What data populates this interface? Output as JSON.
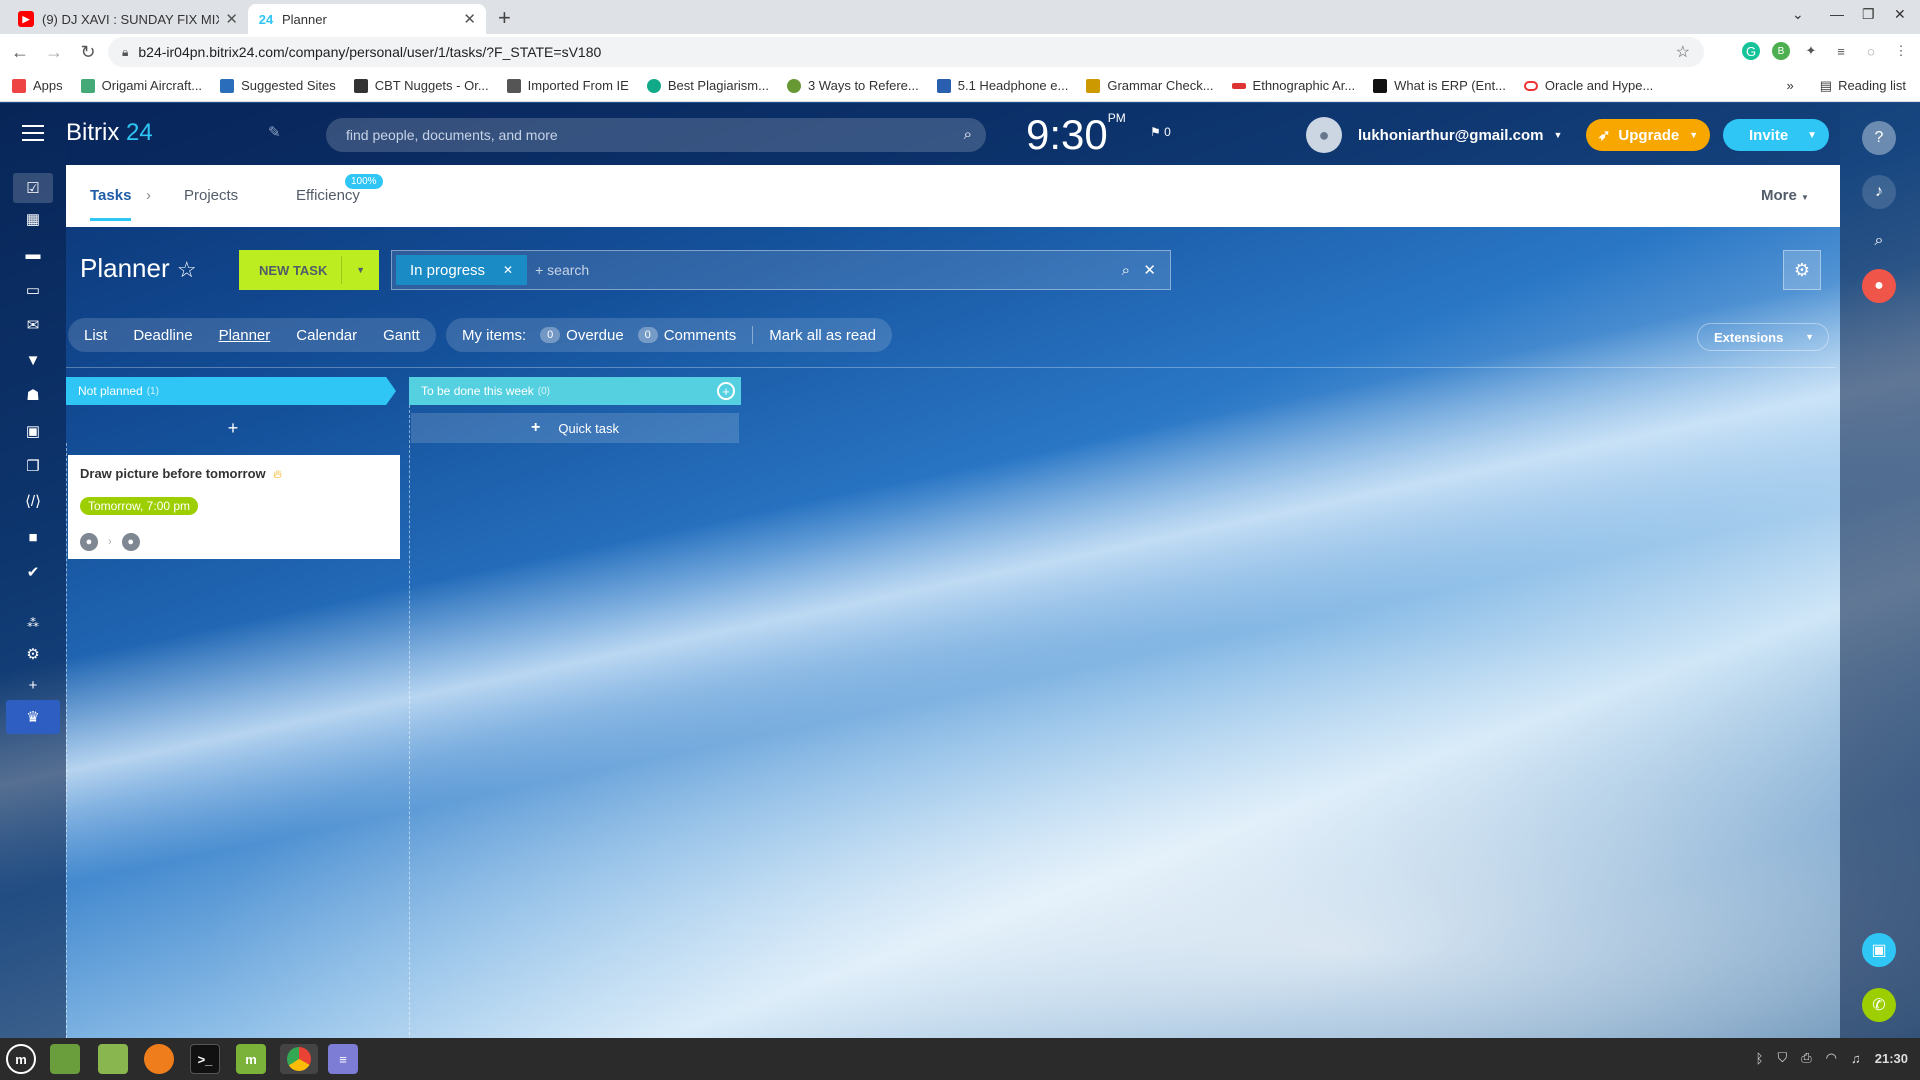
{
  "browser": {
    "tabs": [
      {
        "title": "(9) DJ XAVI : SUNDAY FIX MIX",
        "favicon": "youtube-icon",
        "color": "#ff0000"
      },
      {
        "title": "Planner",
        "favicon": "bitrix-24-icon",
        "favicon_text": "24",
        "color": "#2fc6f6"
      }
    ],
    "url": "b24-ir04pn.bitrix24.com/company/personal/user/1/tasks/?F_STATE=sV180",
    "bookmarks": [
      {
        "label": "Apps",
        "color": "#e44"
      },
      {
        "label": "Origami Aircraft...",
        "color": "#4a7"
      },
      {
        "label": "Suggested Sites",
        "color": "#2a6ebb"
      },
      {
        "label": "CBT Nuggets - Or...",
        "color": "#333"
      },
      {
        "label": "Imported From IE",
        "color": "#555"
      },
      {
        "label": "Best Plagiarism...",
        "color": "#1a8"
      },
      {
        "label": "3 Ways to Refere...",
        "color": "#693"
      },
      {
        "label": "5.1 Headphone e...",
        "color": "#2a5fb0"
      },
      {
        "label": "Grammar Check...",
        "color": "#c90"
      },
      {
        "label": "Ethnographic Ar...",
        "color": "#d33"
      },
      {
        "label": "What is ERP (Ent...",
        "color": "#111"
      },
      {
        "label": "Oracle and Hype...",
        "color": "#e33"
      }
    ],
    "more_bookmarks": "»",
    "reading_list": "Reading list"
  },
  "header": {
    "logo_text": "Bitrix",
    "logo_num": "24",
    "search_placeholder": "find people, documents, and more",
    "clock": "9:30",
    "clock_ampm": "PM",
    "flag_count": "0",
    "user_email": "lukhoniarthur@gmail.com",
    "upgrade_label": "Upgrade",
    "invite_label": "Invite"
  },
  "tasks_nav": {
    "tasks": "Tasks",
    "projects": "Projects",
    "efficiency": "Efficiency",
    "efficiency_badge": "100%",
    "more": "More"
  },
  "planner": {
    "title": "Planner",
    "new_task": "NEW TASK",
    "filter_chip": "In progress",
    "search_placeholder": "+ search",
    "views": [
      "List",
      "Deadline",
      "Planner",
      "Calendar",
      "Gantt"
    ],
    "my_items_label": "My items:",
    "overdue_count": "0",
    "overdue_label": "Overdue",
    "comments_count": "0",
    "comments_label": "Comments",
    "mark_all_read": "Mark all as read",
    "extensions": "Extensions"
  },
  "columns": [
    {
      "title": "Not planned",
      "count": "(1)",
      "color": "#2fc6f6"
    },
    {
      "title": "To be done this week",
      "count": "(0)",
      "color": "#55d0e0"
    }
  ],
  "quick_task": "Quick task",
  "card": {
    "title": "Draw picture before tomorrow",
    "deadline": "Tomorrow, 7:00 pm"
  },
  "taskbar": {
    "time": "21:30"
  }
}
